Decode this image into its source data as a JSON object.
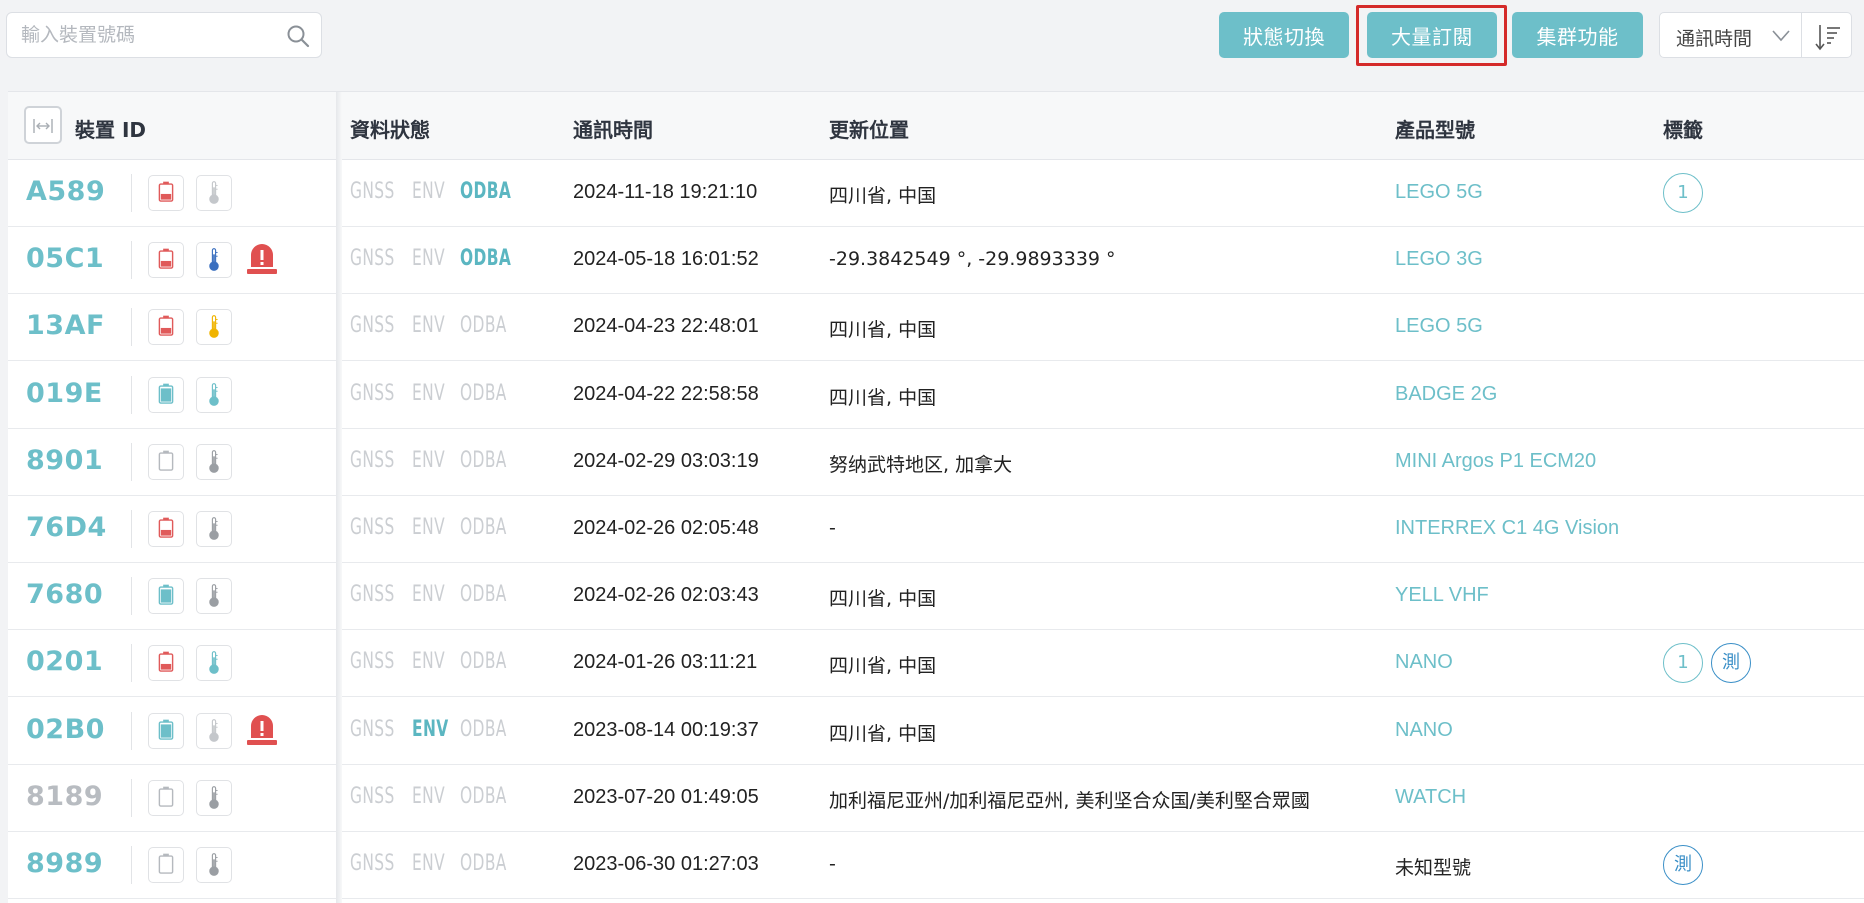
{
  "search": {
    "placeholder": "輸入裝置號碼"
  },
  "toolbar": {
    "status_toggle_label": "狀態切換",
    "bulk_subscribe_label": "大量訂閱",
    "cluster_label": "集群功能",
    "sort_field": "通訊時間"
  },
  "table": {
    "headers": {
      "device_id": "裝置 ID",
      "data_status": "資料狀態",
      "comm_time": "通訊時間",
      "location": "更新位置",
      "model": "產品型號",
      "tags": "標籤"
    },
    "sensor_labels": {
      "gnss": "GNSS",
      "env": "ENV",
      "odba": "ODBA"
    },
    "rows": [
      {
        "id": "A589",
        "online": true,
        "battery": "red",
        "thermo": "gray",
        "alarm": false,
        "gnss": false,
        "env": false,
        "odba": true,
        "time": "2024-11-18 19:21:10",
        "location": "四川省, 中国",
        "model": "LEGO 5G",
        "tags": [
          "1"
        ]
      },
      {
        "id": "05C1",
        "online": true,
        "battery": "red",
        "thermo": "blue",
        "alarm": true,
        "gnss": false,
        "env": false,
        "odba": true,
        "time": "2024-05-18 16:01:52",
        "location": "-29.3842549 °, -29.9893339 °",
        "model": "LEGO 3G",
        "tags": []
      },
      {
        "id": "13AF",
        "online": true,
        "battery": "red",
        "thermo": "yellow",
        "alarm": false,
        "gnss": false,
        "env": false,
        "odba": false,
        "time": "2024-04-23 22:48:01",
        "location": "四川省, 中国",
        "model": "LEGO 5G",
        "tags": []
      },
      {
        "id": "019E",
        "online": true,
        "battery": "teal",
        "thermo": "teal",
        "alarm": false,
        "gnss": false,
        "env": false,
        "odba": false,
        "time": "2024-04-22 22:58:58",
        "location": "四川省, 中国",
        "model": "BADGE 2G",
        "tags": []
      },
      {
        "id": "8901",
        "online": true,
        "battery": "empty",
        "thermo": "darkgray",
        "alarm": false,
        "gnss": false,
        "env": false,
        "odba": false,
        "time": "2024-02-29 03:03:19",
        "location": "努纳武特地区, 加拿大",
        "model": "MINI Argos P1 ECM20",
        "tags": []
      },
      {
        "id": "76D4",
        "online": true,
        "battery": "red",
        "thermo": "darkgray",
        "alarm": false,
        "gnss": false,
        "env": false,
        "odba": false,
        "time": "2024-02-26 02:05:48",
        "location": "-",
        "model": "INTERREX C1 4G Vision",
        "tags": []
      },
      {
        "id": "7680",
        "online": true,
        "battery": "teal",
        "thermo": "darkgray",
        "alarm": false,
        "gnss": false,
        "env": false,
        "odba": false,
        "time": "2024-02-26 02:03:43",
        "location": "四川省, 中国",
        "model": "YELL VHF",
        "tags": []
      },
      {
        "id": "0201",
        "online": true,
        "battery": "red",
        "thermo": "teal",
        "alarm": false,
        "gnss": false,
        "env": false,
        "odba": false,
        "time": "2024-01-26 03:11:21",
        "location": "四川省, 中国",
        "model": "NANO",
        "tags": [
          "1",
          "測"
        ]
      },
      {
        "id": "02B0",
        "online": true,
        "battery": "teal",
        "thermo": "gray",
        "alarm": true,
        "gnss": false,
        "env": true,
        "odba": false,
        "time": "2023-08-14 00:19:37",
        "location": "四川省, 中国",
        "model": "NANO",
        "tags": []
      },
      {
        "id": "8189",
        "online": false,
        "battery": "empty",
        "thermo": "darkgray",
        "alarm": false,
        "gnss": false,
        "env": false,
        "odba": false,
        "time": "2023-07-20 01:49:05",
        "location": "加利福尼亚州/加利福尼亞州, 美利坚合众国/美利堅合眾國",
        "model": "WATCH",
        "tags": []
      },
      {
        "id": "8989",
        "online": true,
        "battery": "empty",
        "thermo": "darkgray",
        "alarm": false,
        "gnss": false,
        "env": false,
        "odba": false,
        "time": "2023-06-30 01:27:03",
        "location": "-",
        "model": "未知型號",
        "model_known": false,
        "tags": [
          "測"
        ]
      }
    ]
  },
  "colors": {
    "accent": "#6dbfc9",
    "battery_red": "#e05a5a",
    "battery_teal": "#6dbfc9",
    "thermo_blue": "#3a6fbf",
    "thermo_yellow": "#f0b400",
    "alarm_red": "#e05050",
    "highlight": "#d42a2a"
  }
}
